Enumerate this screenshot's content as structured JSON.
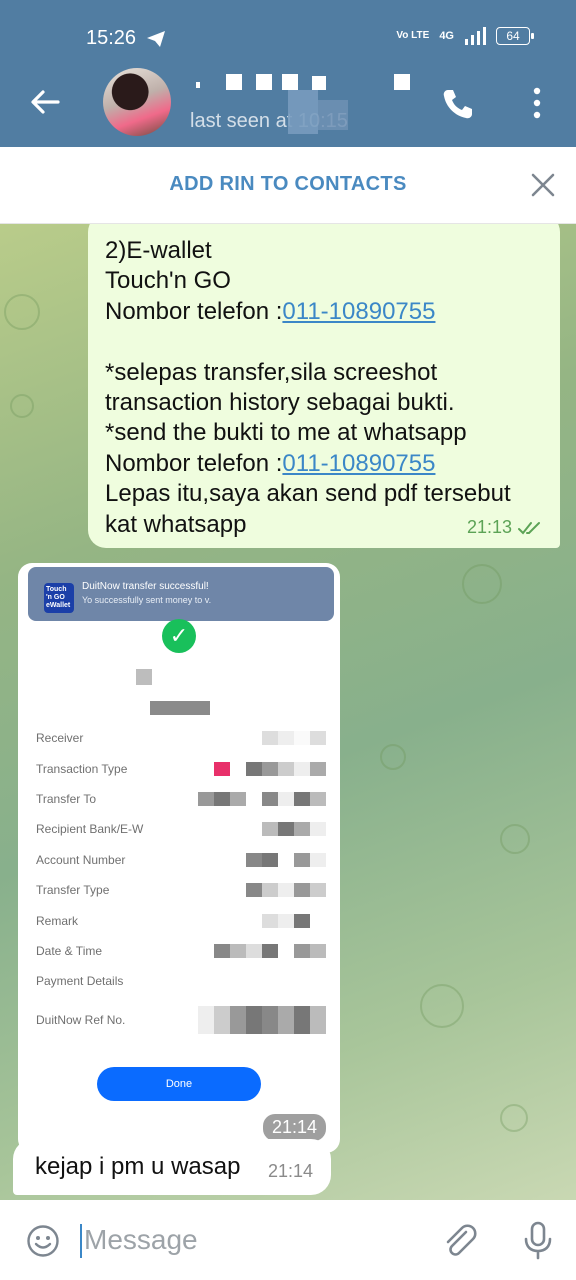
{
  "status_bar": {
    "time": "15:26",
    "network": "4G",
    "volte": "Vo LTE",
    "battery": "64"
  },
  "header": {
    "last_seen": "last seen at 10:15"
  },
  "add_bar": {
    "label": "ADD RIN TO CONTACTS"
  },
  "messages": {
    "outgoing": {
      "lines": [
        "2)E-wallet",
        "Touch'n GO",
        "Nombor telefon :",
        "",
        "*selepas transfer,sila screeshot",
        "transaction history sebagai bukti.",
        "*send the bukti to me at whatsapp",
        "Nombor telefon :",
        "Lepas itu,saya akan send pdf tersebut",
        "kat whatsapp"
      ],
      "phone_link_1": "011-10890755",
      "phone_link_2": "011-10890755",
      "time": "21:13"
    },
    "image": {
      "logo_text": "Touch 'n GO eWallet",
      "notif_title": "DuitNow transfer successful!",
      "notif_body": "Yo      successfully sent money to      v.",
      "rows": [
        {
          "label": "Receiver"
        },
        {
          "label": "Transaction Type"
        },
        {
          "label": "Transfer To"
        },
        {
          "label": "Recipient Bank/E-W"
        },
        {
          "label": "Account Number"
        },
        {
          "label": "Transfer Type"
        },
        {
          "label": "Remark"
        },
        {
          "label": "Date & Time"
        },
        {
          "label": "Payment Details"
        },
        {
          "label": "DuitNow Ref No."
        }
      ],
      "done_label": "Done",
      "time": "21:14"
    },
    "incoming": {
      "text": "kejap i pm u wasap",
      "time": "21:14"
    }
  },
  "input": {
    "placeholder": "Message"
  },
  "colors": {
    "header": "#517da2",
    "accent": "#4a8ac0",
    "outgoing_bubble": "#effdde",
    "link": "#3b87c7",
    "check_green": "#19c05b",
    "done_button": "#0a6bff"
  },
  "icons": [
    "back-arrow-icon",
    "phone-call-icon",
    "more-vert-icon",
    "close-icon",
    "double-check-icon",
    "emoji-icon",
    "attach-icon",
    "mic-icon",
    "telegram-send-icon"
  ]
}
